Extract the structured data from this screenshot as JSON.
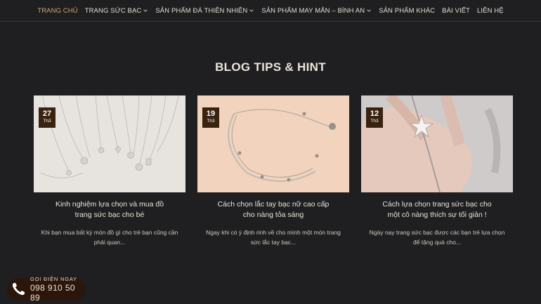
{
  "nav": {
    "items": [
      {
        "label": "TRANG CHỦ",
        "dropdown": false
      },
      {
        "label": "TRANG SỨC BẠC",
        "dropdown": true
      },
      {
        "label": "SẢN PHẨM ĐÁ THIÊN NHIÊN",
        "dropdown": true
      },
      {
        "label": "SẢN PHẨM MAY MẮN – BÌNH AN",
        "dropdown": true
      },
      {
        "label": "SẢN PHẨM KHÁC",
        "dropdown": false
      },
      {
        "label": "BÀI VIẾT",
        "dropdown": false
      },
      {
        "label": "LIÊN HỆ",
        "dropdown": false
      }
    ],
    "active_color": "#c9a877"
  },
  "section": {
    "title": "BLOG TIPS & HINT"
  },
  "posts": [
    {
      "day": "27",
      "month": "Th3",
      "title": "Kinh nghiệm lựa chọn và mua đồ trang sức bạc cho bé",
      "excerpt": "Khi bạn mua bất kỳ món đồ gì cho trẻ bạn cũng cần phải quan..."
    },
    {
      "day": "19",
      "month": "Th3",
      "title": "Cách chọn lắc tay bạc nữ cao cấp cho nàng tỏa sáng",
      "excerpt": "Ngay khi có ý định rinh về cho mình một món trang sức lắc tay bạc..."
    },
    {
      "day": "12",
      "month": "Th3",
      "title": "Cách lựa chọn trang sức bạc cho một cô nàng thích sự tối giản !",
      "excerpt": "Ngày nay trang sức bạc được các bạn trẻ lựa chọn để tặng quà cho..."
    }
  ],
  "call": {
    "label": "GỌI ĐIỆN NGAY",
    "number": "098 910 50 89"
  },
  "colors": {
    "background": "#1f1f21",
    "badge": "#3a2210",
    "call_bg": "#2a160b"
  }
}
